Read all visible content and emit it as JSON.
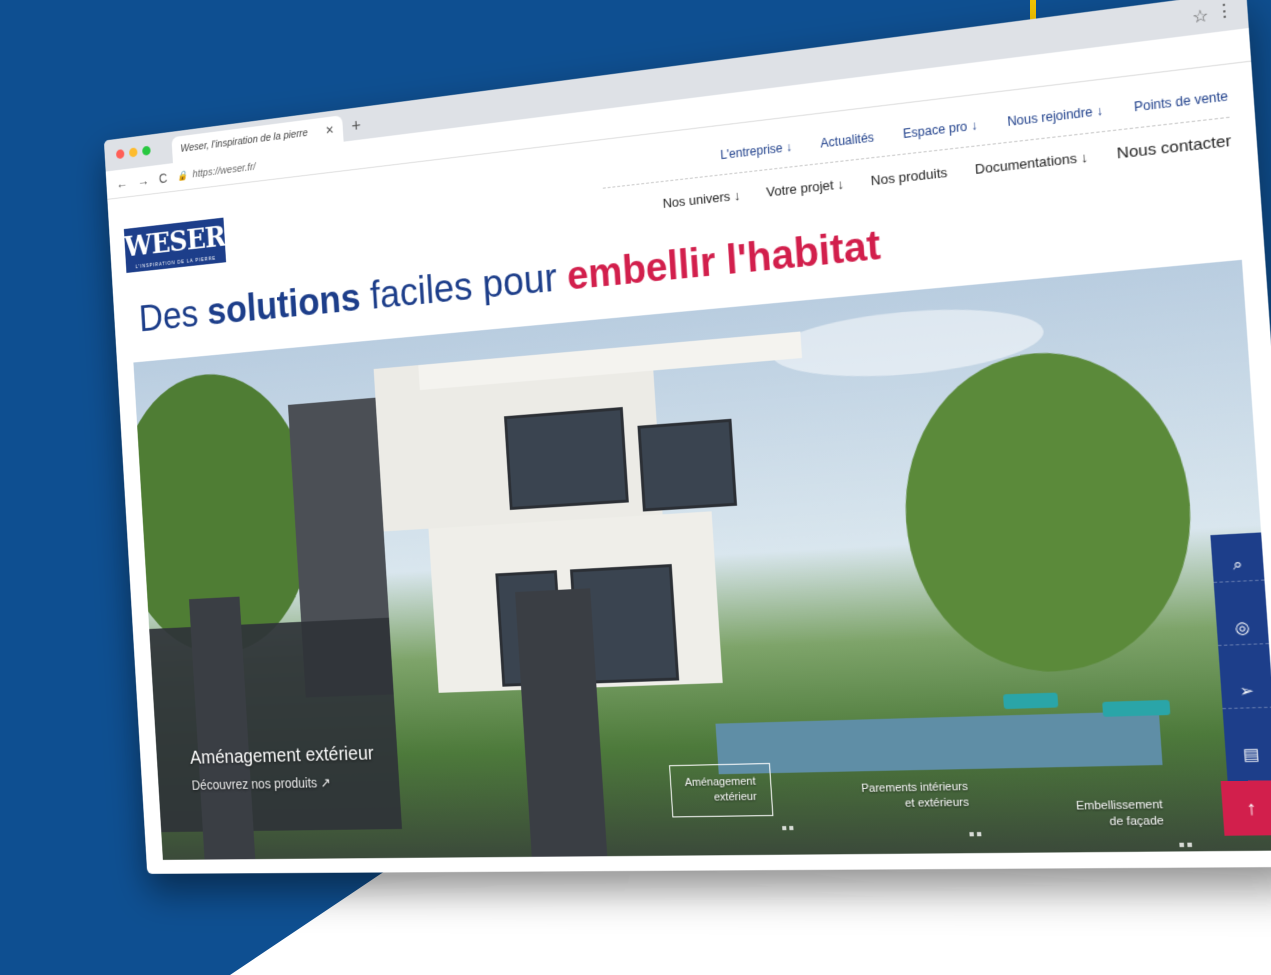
{
  "browser": {
    "tab_title": "Weser, l'inspiration de la pierre",
    "tab_close": "✕",
    "new_tab": "+",
    "url": "https://weser.fr/",
    "star": "☆",
    "menu": "⋮",
    "back": "←",
    "forward": "→",
    "reload": "C",
    "lock": "🔒"
  },
  "logo": {
    "name": "WESER",
    "tagline": "L'INSPIRATION DE LA PIERRE"
  },
  "nav_top": [
    {
      "label": "L'entreprise ↓"
    },
    {
      "label": "Actualités"
    },
    {
      "label": "Espace pro ↓"
    },
    {
      "label": "Nous rejoindre ↓"
    },
    {
      "label": "Points de vente"
    }
  ],
  "nav_main": [
    {
      "label": "Nos univers ↓"
    },
    {
      "label": "Votre projet ↓"
    },
    {
      "label": "Nos produits"
    },
    {
      "label": "Documentations ↓"
    },
    {
      "label": "Nous contacter"
    }
  ],
  "headline": {
    "part1": "Des ",
    "bold": "solutions",
    "part2": " faciles pour ",
    "accent": "embellir l'habitat"
  },
  "hero": {
    "title": "Aménagement extérieur",
    "link": "Découvrez nos produits ↗"
  },
  "slides": [
    {
      "line1": "Aménagement",
      "line2": "extérieur"
    },
    {
      "line1": "Parements intérieurs",
      "line2": "et extérieurs"
    },
    {
      "line1": "Embellissement",
      "line2": "de façade"
    }
  ],
  "sidebar_icons": [
    "search-icon",
    "location-icon",
    "send-icon",
    "document-icon"
  ],
  "sidebar_glyphs": [
    "⌕",
    "◎",
    "➢",
    "▤"
  ],
  "scroll_top": "↑",
  "colors": {
    "brand_blue": "#1d3e8a",
    "accent_red": "#d21f4c",
    "background_blue": "#0e4f91"
  }
}
